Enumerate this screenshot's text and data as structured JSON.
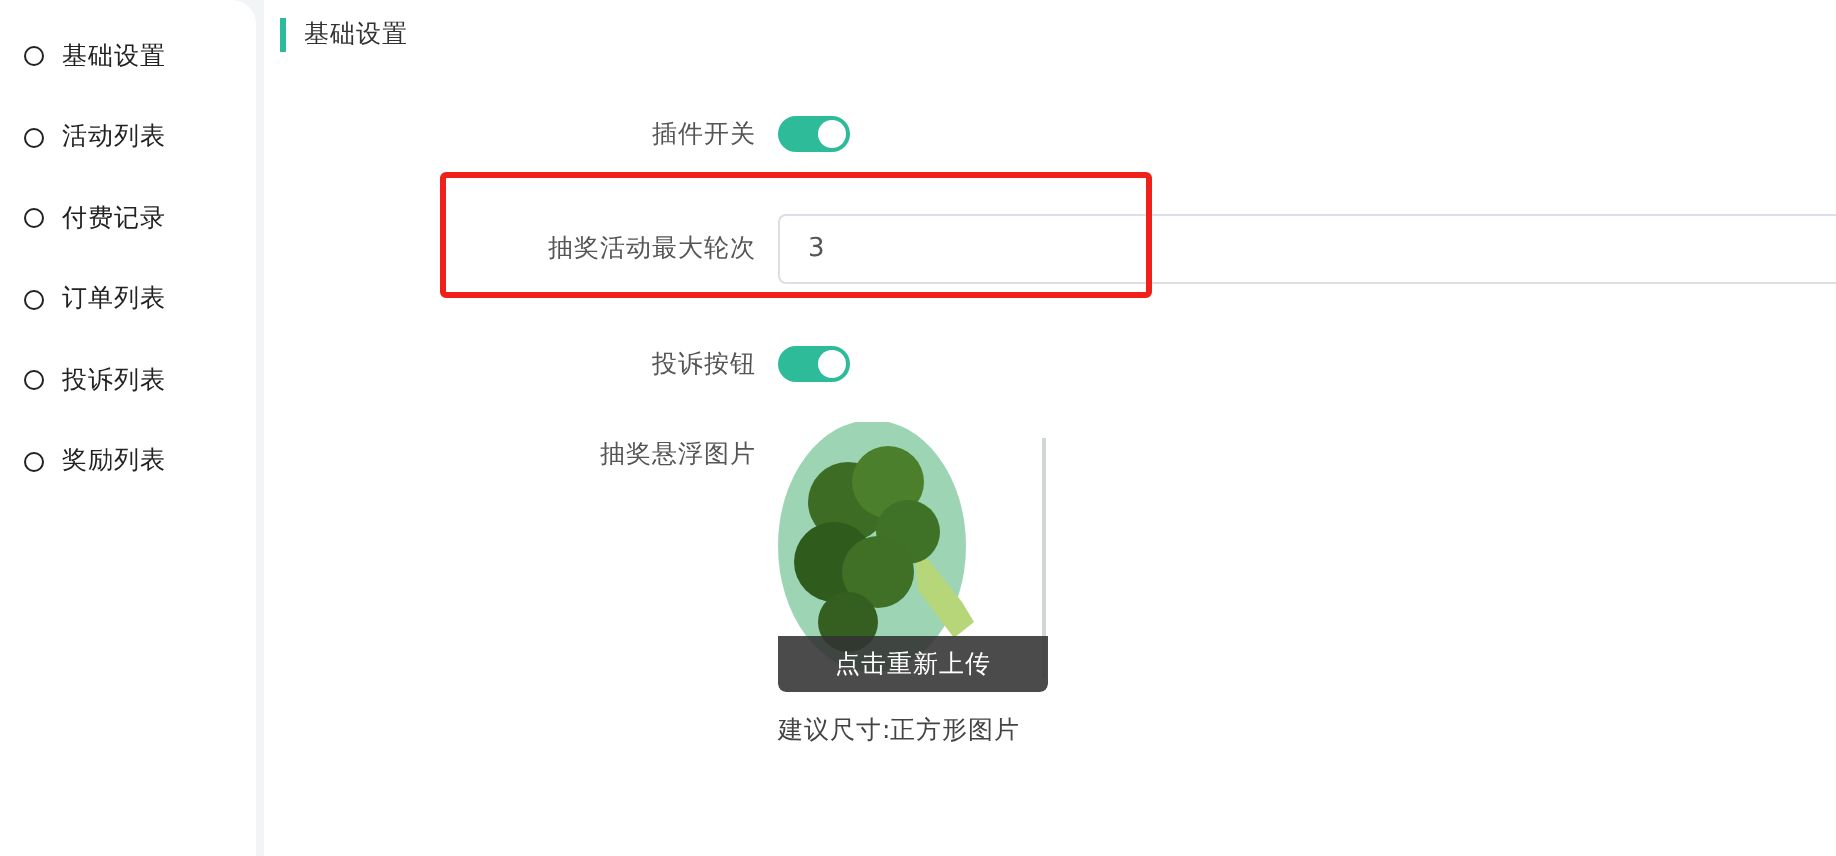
{
  "sidebar": {
    "items": [
      {
        "label": "基础设置",
        "selected": false
      },
      {
        "label": "活动列表",
        "selected": false
      },
      {
        "label": "付费记录",
        "selected": false
      },
      {
        "label": "订单列表",
        "selected": false
      },
      {
        "label": "投诉列表",
        "selected": false
      },
      {
        "label": "奖励列表",
        "selected": false
      }
    ]
  },
  "section_title": "基础设置",
  "form": [
    {
      "kind": "switch",
      "label": "插件开关",
      "on": true,
      "highlighted": false
    },
    {
      "kind": "input",
      "label": "抽奖活动最大轮次",
      "value": "3",
      "highlighted": true
    },
    {
      "kind": "switch",
      "label": "投诉按钮",
      "on": true,
      "highlighted": false
    },
    {
      "label": "抽奖悬浮图片",
      "upload_button": "点击重新上传",
      "hint": "建议尺寸:正方形图片",
      "highlighted": false
    }
  ]
}
